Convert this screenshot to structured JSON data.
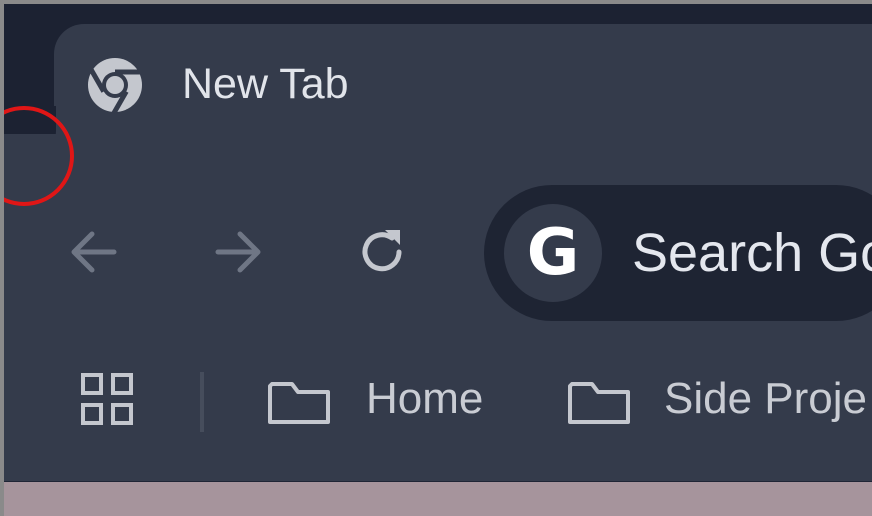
{
  "tab": {
    "title": "New Tab",
    "favicon": "chrome-icon"
  },
  "toolbar": {
    "back_icon": "arrow-left-icon",
    "forward_icon": "arrow-right-icon",
    "reload_icon": "reload-icon",
    "search_engine_icon": "google-g-icon",
    "search_engine_letter": "G",
    "omnibox_placeholder": "Search Go"
  },
  "bookmarks": {
    "apps_icon": "apps-grid-icon",
    "items": [
      {
        "label": "Home",
        "icon": "folder-icon"
      },
      {
        "label": "Side Proje",
        "icon": "folder-icon"
      }
    ]
  },
  "annotation": {
    "marker": "red-circle-highlight"
  },
  "colors": {
    "titlebar": "#1c2232",
    "toolbar": "#343b4b",
    "omnibox": "#1e2433",
    "text": "#e1e4ea",
    "highlight": "#e01616"
  }
}
